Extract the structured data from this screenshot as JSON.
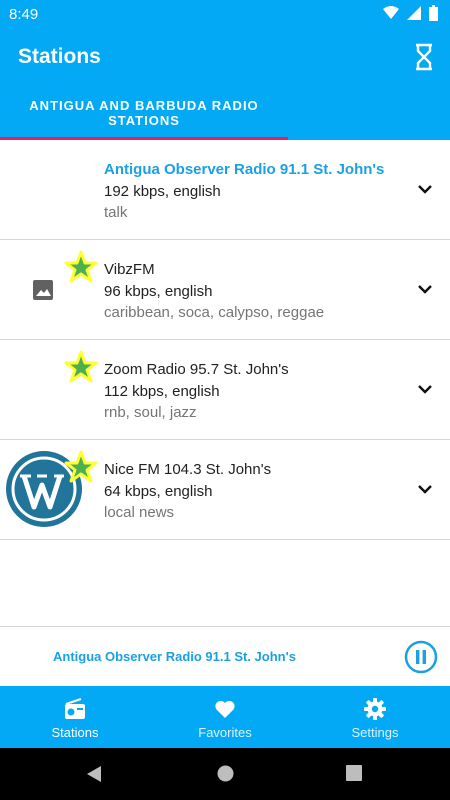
{
  "status_bar": {
    "time": "8:49",
    "icons": [
      "wifi-icon",
      "signal-icon",
      "battery-icon"
    ]
  },
  "app_bar": {
    "title": "Stations",
    "action_icon": "hourglass-icon"
  },
  "tabs": [
    {
      "label": "ANTIGUA AND BARBUDA RADIO STATIONS",
      "selected": true
    }
  ],
  "stations": [
    {
      "name": "Antigua Observer Radio 91.1 St. John's",
      "meta": "192 kbps, english",
      "tags": "talk",
      "playing": true,
      "favorite": false,
      "thumbnail": "none"
    },
    {
      "name": "VibzFM",
      "meta": "96 kbps, english",
      "tags": "caribbean, soca, calypso, reggae",
      "playing": false,
      "favorite": true,
      "thumbnail": "image-placeholder-icon"
    },
    {
      "name": "Zoom Radio 95.7 St. John's",
      "meta": "112 kbps, english",
      "tags": "rnb, soul, jazz",
      "playing": false,
      "favorite": true,
      "thumbnail": "none"
    },
    {
      "name": "Nice FM 104.3 St. John's",
      "meta": "64 kbps, english",
      "tags": "local news",
      "playing": false,
      "favorite": true,
      "thumbnail": "wordpress-logo"
    }
  ],
  "player": {
    "now_playing": "Antigua Observer Radio 91.1 St. John's",
    "state_icon": "pause-icon"
  },
  "bottom_nav": [
    {
      "label": "Stations",
      "icon": "radio-icon",
      "selected": true
    },
    {
      "label": "Favorites",
      "icon": "heart-icon",
      "selected": false
    },
    {
      "label": "Settings",
      "icon": "gear-icon",
      "selected": false
    }
  ],
  "colors": {
    "primary": "#03a9f4",
    "accent": "#e91e63",
    "link": "#1ba1e2",
    "star_fill": "#4caf50",
    "star_glow": "#ffff33"
  }
}
